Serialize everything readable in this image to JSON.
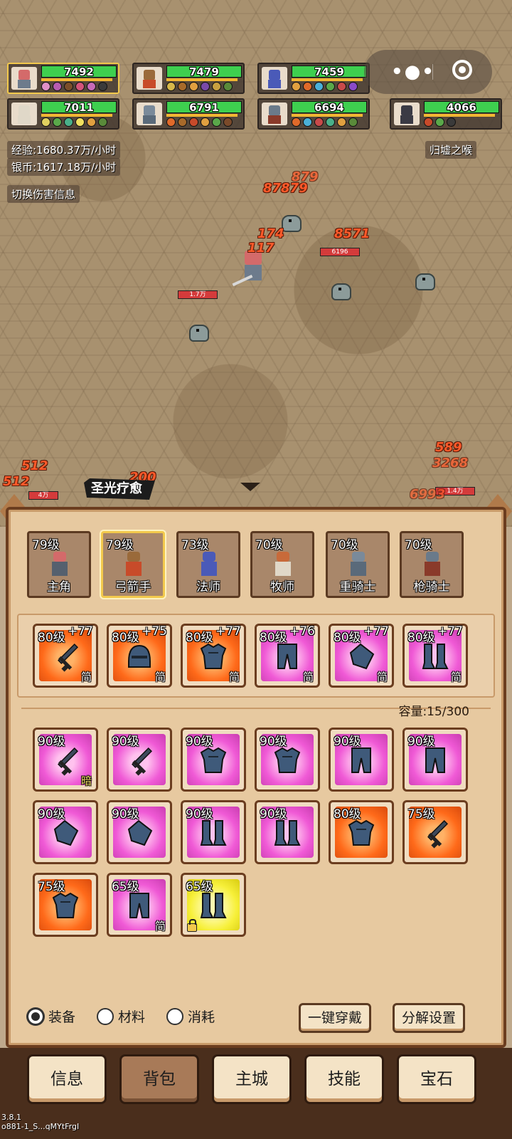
{
  "party": [
    {
      "hp": "7492",
      "selected": true
    },
    {
      "hp": "7479",
      "selected": false
    },
    {
      "hp": "7459",
      "selected": false
    },
    {
      "hp": "7011",
      "selected": false
    },
    {
      "hp": "6791",
      "selected": false
    },
    {
      "hp": "6694",
      "selected": false
    },
    {
      "hp": "4066",
      "selected": false
    }
  ],
  "stats": {
    "exp": "经验:1680.37万/小时",
    "silver": "银币:1617.18万/小时",
    "toggle_damage": "切换伤害信息",
    "area_name": "归墟之喉"
  },
  "capsule": {
    "more_icon": "more-dots-icon",
    "close_icon": "target-ring-icon"
  },
  "battle": {
    "damage_numbers": [
      "879",
      "87879",
      "174",
      "8571",
      "117",
      "512",
      "512",
      "589",
      "3268",
      "6993",
      "200"
    ],
    "enemy_hp_labels": [
      "6196",
      "1.7万",
      "4万",
      "1.4万"
    ],
    "skill_banner": "圣光疗愈"
  },
  "classes": [
    {
      "level": "79级",
      "name": "主角",
      "selected": false
    },
    {
      "level": "79级",
      "name": "弓箭手",
      "selected": true
    },
    {
      "level": "73级",
      "name": "法师",
      "selected": false
    },
    {
      "level": "70级",
      "name": "牧师",
      "selected": false
    },
    {
      "level": "70级",
      "name": "重骑士",
      "selected": false
    },
    {
      "level": "70级",
      "name": "枪骑士",
      "selected": false
    }
  ],
  "equipped": [
    {
      "level": "80级",
      "plus": "+77",
      "tag": "简",
      "rarity": "orange",
      "icon": "sword-icon"
    },
    {
      "level": "80级",
      "plus": "+75",
      "tag": "简",
      "rarity": "orange",
      "icon": "helmet-icon"
    },
    {
      "level": "80级",
      "plus": "+77",
      "tag": "简",
      "rarity": "orange",
      "icon": "chest-armor-icon"
    },
    {
      "level": "80级",
      "plus": "+76",
      "tag": "简",
      "rarity": "pink",
      "icon": "leg-armor-icon"
    },
    {
      "level": "80级",
      "plus": "+77",
      "tag": "简",
      "rarity": "pink",
      "icon": "gauntlet-icon"
    },
    {
      "level": "80级",
      "plus": "+77",
      "tag": "简",
      "rarity": "pink",
      "icon": "boots-icon"
    }
  ],
  "capacity": "容量:15/300",
  "inventory": [
    {
      "level": "90级",
      "tag": "暗",
      "rarity": "pink",
      "icon": "sword-icon",
      "locked": false
    },
    {
      "level": "90级",
      "tag": "",
      "rarity": "pink",
      "icon": "sword-icon",
      "locked": false
    },
    {
      "level": "90级",
      "tag": "",
      "rarity": "pink",
      "icon": "chest-armor-icon",
      "locked": false
    },
    {
      "level": "90级",
      "tag": "",
      "rarity": "pink",
      "icon": "chest-armor-icon",
      "locked": false
    },
    {
      "level": "90级",
      "tag": "",
      "rarity": "pink",
      "icon": "leg-armor-icon",
      "locked": false
    },
    {
      "level": "90级",
      "tag": "",
      "rarity": "pink",
      "icon": "leg-armor-icon",
      "locked": false
    },
    {
      "level": "90级",
      "tag": "",
      "rarity": "pink",
      "icon": "gauntlet-icon",
      "locked": false
    },
    {
      "level": "90级",
      "tag": "",
      "rarity": "pink",
      "icon": "gauntlet-icon",
      "locked": false
    },
    {
      "level": "90级",
      "tag": "",
      "rarity": "pink",
      "icon": "boots-icon",
      "locked": false
    },
    {
      "level": "90级",
      "tag": "",
      "rarity": "pink",
      "icon": "boots-icon",
      "locked": false
    },
    {
      "level": "80级",
      "tag": "",
      "rarity": "orange",
      "icon": "chest-armor-icon",
      "locked": false
    },
    {
      "level": "75级",
      "tag": "",
      "rarity": "orange",
      "icon": "sword-icon",
      "locked": false
    },
    {
      "level": "75级",
      "tag": "",
      "rarity": "orange",
      "icon": "chest-armor-icon",
      "locked": false
    },
    {
      "level": "65级",
      "tag": "简",
      "rarity": "pink",
      "icon": "leg-armor-icon",
      "locked": false
    },
    {
      "level": "65级",
      "tag": "",
      "rarity": "yellow",
      "icon": "boots-icon",
      "locked": true
    }
  ],
  "filters": [
    {
      "label": "装备",
      "checked": true
    },
    {
      "label": "材料",
      "checked": false
    },
    {
      "label": "消耗",
      "checked": false
    }
  ],
  "actions": {
    "equip_all": "一键穿戴",
    "decompose_settings": "分解设置"
  },
  "nav": [
    {
      "label": "信息",
      "active": false
    },
    {
      "label": "背包",
      "active": true
    },
    {
      "label": "主城",
      "active": false
    },
    {
      "label": "技能",
      "active": false
    },
    {
      "label": "宝石",
      "active": false
    }
  ],
  "version": {
    "line1": "3.8.1",
    "line2": "o881-1_S...qMYtFrgI"
  },
  "colors": {
    "hp": "#3ecf4f",
    "mp": "#f2b632",
    "rarity_orange": "#ff6a1a",
    "rarity_pink": "#f05ad6",
    "rarity_yellow": "#f7f03a",
    "panel": "#e7c9a0",
    "panel_border": "#6b3d1f"
  }
}
